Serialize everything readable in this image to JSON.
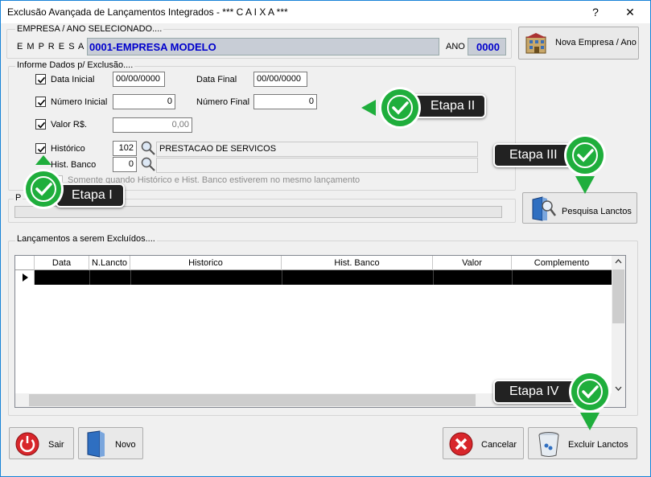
{
  "window": {
    "title": "Exclusão Avançada de Lançamentos Integrados - *** C A I X A ***",
    "help": "?",
    "close": "✕"
  },
  "company": {
    "section_label": "EMPRESA  /  ANO  SELECIONADO....",
    "empresa_label": "E M P R E S A",
    "empresa_value": "0001-EMPRESA MODELO",
    "ano_label": "ANO",
    "ano_value": "0000",
    "nova_button": "Nova Empresa / Ano"
  },
  "filters": {
    "legend": "Informe Dados p/ Exclusão....",
    "data_inicial_label": "Data Inicial",
    "data_inicial_value": "00/00/0000",
    "data_final_label": "Data Final",
    "data_final_value": "00/00/0000",
    "numero_inicial_label": "Número Inicial",
    "numero_inicial_value": "0",
    "numero_final_label": "Número Final",
    "numero_final_value": "0",
    "valor_label": "Valor R$.",
    "valor_value": "0,00",
    "historico_label": "Histórico",
    "historico_code": "102",
    "historico_desc": "PRESTACAO DE SERVICOS",
    "hist_banco_label": "Hist. Banco",
    "hist_banco_code": "0",
    "hist_banco_desc": "",
    "somente_label": "Somente quando Histórico e Hist. Banco estiverem no mesmo lançamento",
    "progress_legend": "P"
  },
  "search_button": "Pesquisa Lanctos",
  "grid": {
    "legend": "Lançamentos a serem Excluídos....",
    "columns": [
      "Data",
      "N.Lancto",
      "Historico",
      "Hist. Banco",
      "Valor",
      "Complemento"
    ]
  },
  "buttons": {
    "sair": "Sair",
    "novo": "Novo",
    "cancelar": "Cancelar",
    "excluir": "Excluir Lanctos"
  },
  "callouts": {
    "etapa1": "Etapa I",
    "etapa2": "Etapa II",
    "etapa3": "Etapa III",
    "etapa4": "Etapa IV"
  },
  "colors": {
    "accent_blue": "#0000cc",
    "badge_green": "#1fae3c",
    "callout_bg": "#222222"
  },
  "icons": [
    "help-icon",
    "close-icon",
    "checkmark-icon",
    "magnifier-icon",
    "power-icon",
    "door-icon",
    "cancel-icon",
    "trash-icon",
    "search-book-icon",
    "building-icon"
  ]
}
